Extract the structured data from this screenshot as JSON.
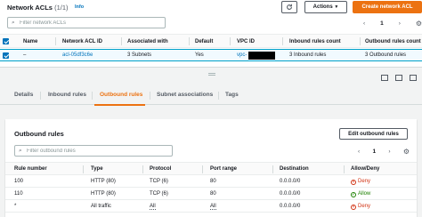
{
  "header": {
    "title": "Network ACLs",
    "count": "(1/1)",
    "info": "Info",
    "actions_label": "Actions",
    "create_label": "Create network ACL"
  },
  "search": {
    "placeholder": "Filter network ACLs"
  },
  "pager": {
    "page": "1"
  },
  "acl_table": {
    "columns": [
      "Name",
      "Network ACL ID",
      "Associated with",
      "Default",
      "VPC ID",
      "Inbound rules count",
      "Outbound rules count"
    ],
    "row": {
      "name": "–",
      "acl_id": "acl-05df3c6e",
      "associated": "3 Subnets",
      "default": "Yes",
      "vpc_id": "vpc-",
      "inbound": "3 Inbound rules",
      "outbound": "3 Outbound rules"
    }
  },
  "tabs": [
    "Details",
    "Inbound rules",
    "Outbound rules",
    "Subnet associations",
    "Tags"
  ],
  "active_tab": "Outbound rules",
  "outbound": {
    "title": "Outbound rules",
    "edit_label": "Edit outbound rules",
    "search_placeholder": "Filter outbound rules",
    "page": "1",
    "columns": [
      "Rule number",
      "Type",
      "Protocol",
      "Port range",
      "Destination",
      "Allow/Deny"
    ],
    "rows": [
      {
        "rule": "100",
        "type": "HTTP (80)",
        "protocol": "TCP (6)",
        "port": "80",
        "dest": "0.0.0.0/0",
        "action": "Deny"
      },
      {
        "rule": "110",
        "type": "HTTP (80)",
        "protocol": "TCP (6)",
        "port": "80",
        "dest": "0.0.0.0/0",
        "action": "Allow"
      },
      {
        "rule": "*",
        "type": "All traffic",
        "protocol": "All",
        "port": "All",
        "dest": "0.0.0.0/0",
        "action": "Deny"
      }
    ]
  },
  "colors": {
    "accent": "#ec7211",
    "link": "#0073bb",
    "deny": "#d13212",
    "allow": "#1d8102"
  }
}
